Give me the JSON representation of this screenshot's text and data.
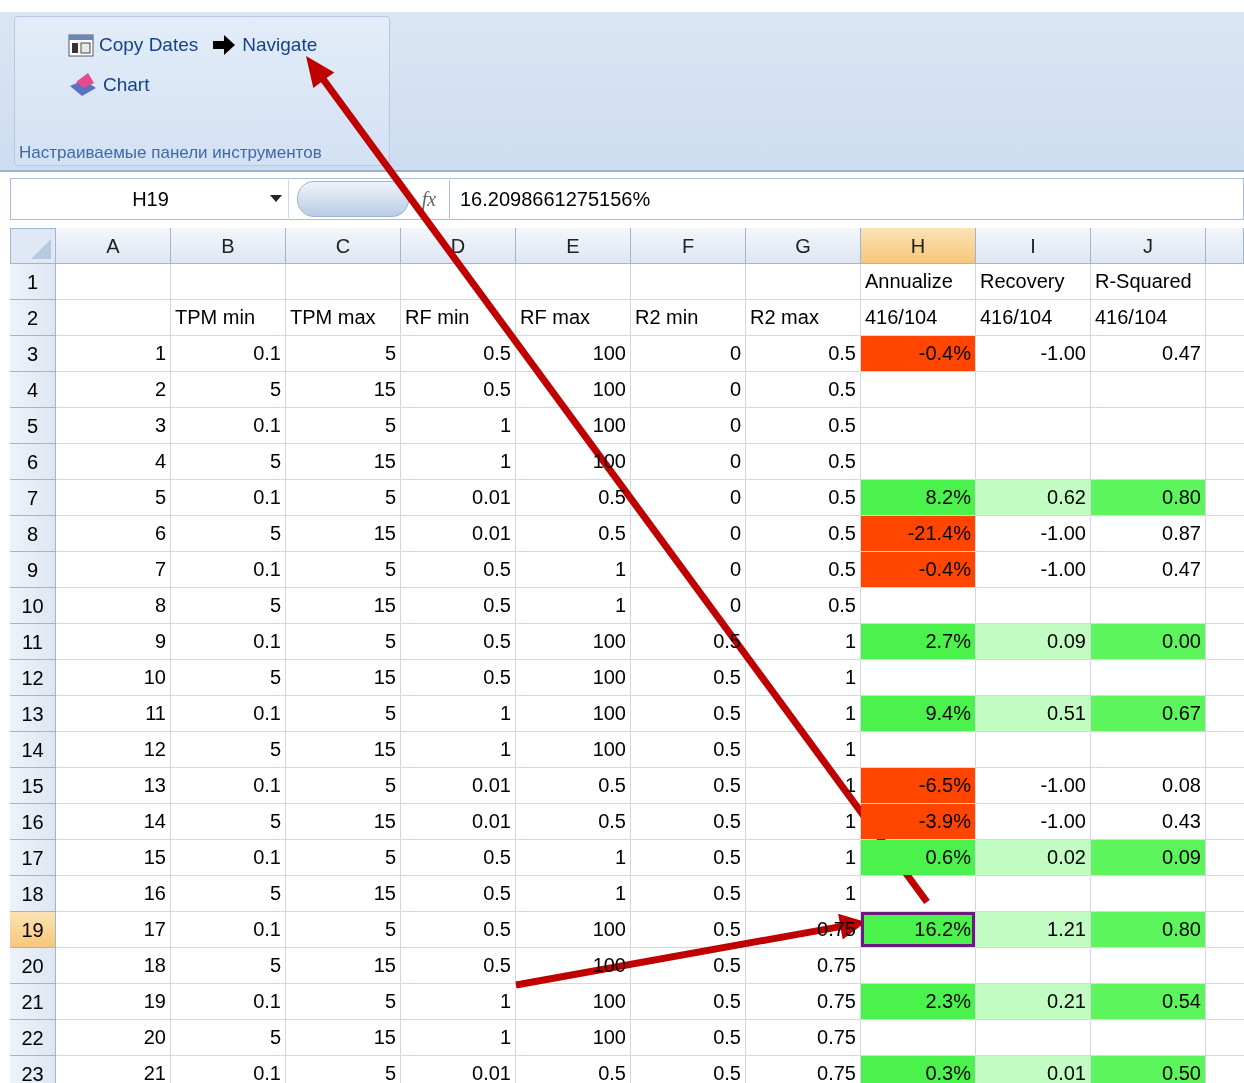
{
  "ribbon": {
    "buttons": [
      {
        "kind": "calendar",
        "label": "Copy Dates"
      },
      {
        "kind": "arrow",
        "label": "Navigate"
      },
      {
        "kind": "chart",
        "label": "Chart"
      }
    ],
    "group_label": "Настраиваемые панели инструментов"
  },
  "formula_bar": {
    "name_box": "H19",
    "fx": "fx",
    "formula": "16.2098661275156%"
  },
  "columns": [
    {
      "label": "A",
      "selected": false
    },
    {
      "label": "B",
      "selected": false
    },
    {
      "label": "C",
      "selected": false
    },
    {
      "label": "D",
      "selected": false
    },
    {
      "label": "E",
      "selected": false
    },
    {
      "label": "F",
      "selected": false
    },
    {
      "label": "G",
      "selected": false
    },
    {
      "label": "H",
      "selected": true
    },
    {
      "label": "I",
      "selected": false
    },
    {
      "label": "J",
      "selected": false
    }
  ],
  "rows": [
    {
      "number": "1",
      "selected": false,
      "kind": "header",
      "cells": [
        "",
        "",
        "",
        "",
        "",
        "",
        "",
        "Annualize",
        "Recovery",
        "R-Squared"
      ]
    },
    {
      "number": "2",
      "selected": false,
      "kind": "header",
      "cells": [
        "",
        "TPM min",
        "TPM max",
        "RF min",
        "RF max",
        "R2 min",
        "R2 max",
        "416/104",
        "416/104",
        "416/104"
      ]
    },
    {
      "number": "3",
      "selected": false,
      "kind": "data",
      "cells": [
        "1",
        "0.1",
        "5",
        "0.5",
        "100",
        "0",
        "0.5",
        {
          "text": "-0.4%",
          "color": "#ff4500"
        },
        "-1.00",
        "0.47"
      ]
    },
    {
      "number": "4",
      "selected": false,
      "kind": "data",
      "cells": [
        "2",
        "5",
        "15",
        "0.5",
        "100",
        "0",
        "0.5",
        "",
        "",
        ""
      ]
    },
    {
      "number": "5",
      "selected": false,
      "kind": "data",
      "cells": [
        "3",
        "0.1",
        "5",
        "1",
        "100",
        "0",
        "0.5",
        "",
        "",
        ""
      ]
    },
    {
      "number": "6",
      "selected": false,
      "kind": "data",
      "cells": [
        "4",
        "5",
        "15",
        "1",
        "100",
        "0",
        "0.5",
        "",
        "",
        ""
      ]
    },
    {
      "number": "7",
      "selected": false,
      "kind": "data",
      "cells": [
        "5",
        "0.1",
        "5",
        "0.01",
        "0.5",
        "0",
        "0.5",
        {
          "text": "8.2%",
          "color": "#4cf24c"
        },
        {
          "text": "0.62",
          "color": "#c2fcc2"
        },
        {
          "text": "0.80",
          "color": "#5cf55c"
        }
      ]
    },
    {
      "number": "8",
      "selected": false,
      "kind": "data",
      "cells": [
        "6",
        "5",
        "15",
        "0.01",
        "0.5",
        "0",
        "0.5",
        {
          "text": "-21.4%",
          "color": "#ff4500"
        },
        "-1.00",
        "0.87"
      ]
    },
    {
      "number": "9",
      "selected": false,
      "kind": "data",
      "cells": [
        "7",
        "0.1",
        "5",
        "0.5",
        "1",
        "0",
        "0.5",
        {
          "text": "-0.4%",
          "color": "#ff4500"
        },
        "-1.00",
        "0.47"
      ]
    },
    {
      "number": "10",
      "selected": false,
      "kind": "data",
      "cells": [
        "8",
        "5",
        "15",
        "0.5",
        "1",
        "0",
        "0.5",
        "",
        "",
        ""
      ]
    },
    {
      "number": "11",
      "selected": false,
      "kind": "data",
      "cells": [
        "9",
        "0.1",
        "5",
        "0.5",
        "100",
        "0.5",
        "1",
        {
          "text": "2.7%",
          "color": "#4cf24c"
        },
        {
          "text": "0.09",
          "color": "#c2fcc2"
        },
        {
          "text": "0.00",
          "color": "#5cf55c"
        }
      ]
    },
    {
      "number": "12",
      "selected": false,
      "kind": "data",
      "cells": [
        "10",
        "5",
        "15",
        "0.5",
        "100",
        "0.5",
        "1",
        "",
        "",
        ""
      ]
    },
    {
      "number": "13",
      "selected": false,
      "kind": "data",
      "cells": [
        "11",
        "0.1",
        "5",
        "1",
        "100",
        "0.5",
        "1",
        {
          "text": "9.4%",
          "color": "#4cf24c"
        },
        {
          "text": "0.51",
          "color": "#c2fcc2"
        },
        {
          "text": "0.67",
          "color": "#5cf55c"
        }
      ]
    },
    {
      "number": "14",
      "selected": false,
      "kind": "data",
      "cells": [
        "12",
        "5",
        "15",
        "1",
        "100",
        "0.5",
        "1",
        "",
        "",
        ""
      ]
    },
    {
      "number": "15",
      "selected": false,
      "kind": "data",
      "cells": [
        "13",
        "0.1",
        "5",
        "0.01",
        "0.5",
        "0.5",
        "1",
        {
          "text": "-6.5%",
          "color": "#ff4500"
        },
        "-1.00",
        "0.08"
      ]
    },
    {
      "number": "16",
      "selected": false,
      "kind": "data",
      "cells": [
        "14",
        "5",
        "15",
        "0.01",
        "0.5",
        "0.5",
        "1",
        {
          "text": "-3.9%",
          "color": "#ff4500"
        },
        "-1.00",
        "0.43"
      ]
    },
    {
      "number": "17",
      "selected": false,
      "kind": "data",
      "cells": [
        "15",
        "0.1",
        "5",
        "0.5",
        "1",
        "0.5",
        "1",
        {
          "text": "0.6%",
          "color": "#4cf24c"
        },
        {
          "text": "0.02",
          "color": "#c2fcc2"
        },
        {
          "text": "0.09",
          "color": "#5cf55c"
        }
      ]
    },
    {
      "number": "18",
      "selected": false,
      "kind": "data",
      "cells": [
        "16",
        "5",
        "15",
        "0.5",
        "1",
        "0.5",
        "1",
        "",
        "",
        ""
      ]
    },
    {
      "number": "19",
      "selected": true,
      "kind": "data",
      "cells": [
        "17",
        "0.1",
        "5",
        "0.5",
        "100",
        "0.5",
        "0.75",
        {
          "text": "16.2%",
          "color": "#4cf24c"
        },
        {
          "text": "1.21",
          "color": "#c2fcc2"
        },
        {
          "text": "0.80",
          "color": "#5cf55c"
        }
      ]
    },
    {
      "number": "20",
      "selected": false,
      "kind": "data",
      "cells": [
        "18",
        "5",
        "15",
        "0.5",
        "100",
        "0.5",
        "0.75",
        "",
        "",
        ""
      ]
    },
    {
      "number": "21",
      "selected": false,
      "kind": "data",
      "cells": [
        "19",
        "0.1",
        "5",
        "1",
        "100",
        "0.5",
        "0.75",
        {
          "text": "2.3%",
          "color": "#4cf24c"
        },
        {
          "text": "0.21",
          "color": "#c2fcc2"
        },
        {
          "text": "0.54",
          "color": "#5cf55c"
        }
      ]
    },
    {
      "number": "22",
      "selected": false,
      "kind": "data",
      "cells": [
        "20",
        "5",
        "15",
        "1",
        "100",
        "0.5",
        "0.75",
        "",
        "",
        ""
      ]
    },
    {
      "number": "23",
      "selected": false,
      "kind": "data",
      "cells": [
        "21",
        "0.1",
        "5",
        "0.01",
        "0.5",
        "0.5",
        "0.75",
        {
          "text": "0.3%",
          "color": "#4cf24c"
        },
        {
          "text": "0.01",
          "color": "#c2fcc2"
        },
        {
          "text": "0.50",
          "color": "#5cf55c"
        }
      ]
    }
  ]
}
